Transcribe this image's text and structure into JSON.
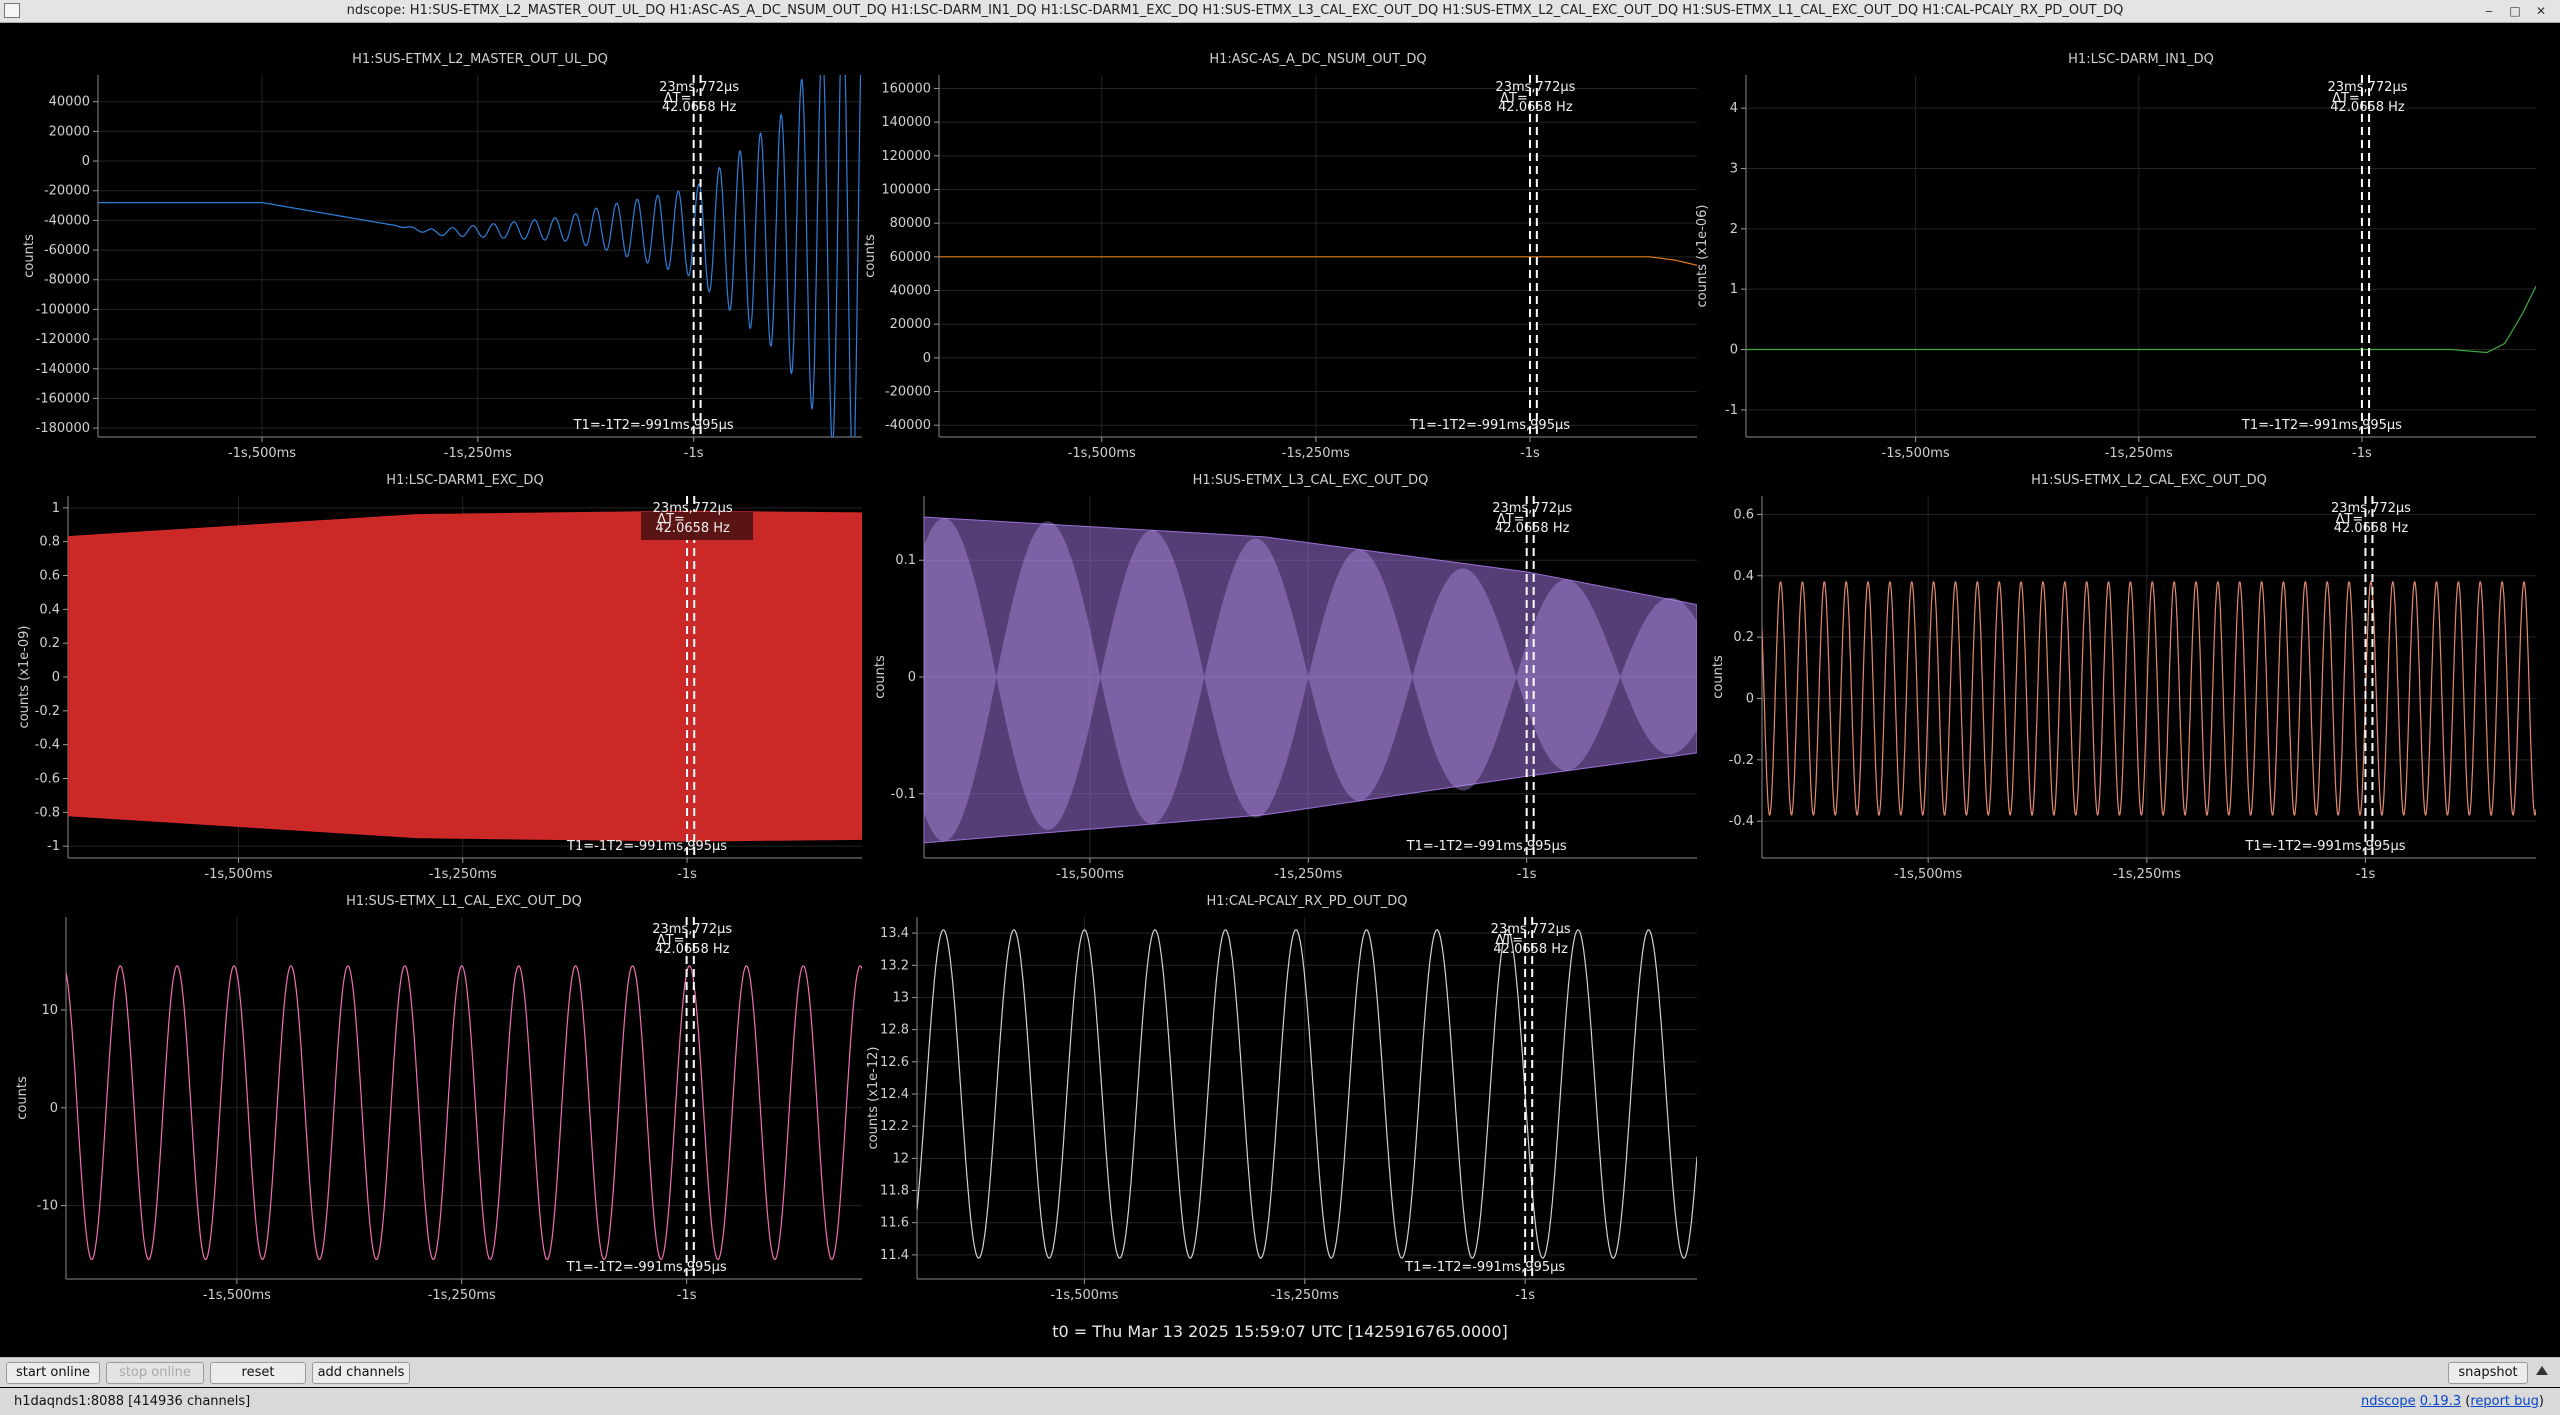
{
  "window": {
    "title": "ndscope: H1:SUS-ETMX_L2_MASTER_OUT_UL_DQ H1:ASC-AS_A_DC_NSUM_OUT_DQ H1:LSC-DARM_IN1_DQ H1:LSC-DARM1_EXC_DQ H1:SUS-ETMX_L3_CAL_EXC_OUT_DQ H1:SUS-ETMX_L2_CAL_EXC_OUT_DQ H1:SUS-ETMX_L1_CAL_EXC_OUT_DQ H1:CAL-PCALY_RX_PD_OUT_DQ",
    "minimize_glyph": "‒",
    "maximize_glyph": "□",
    "close_glyph": "✕"
  },
  "cursor": {
    "delta_label": "ΔT=",
    "delta_time": "23ms,772μs",
    "delta_freq": "42.0658 Hz",
    "t1_label": "T1=-1",
    "t2_label": "T2=-991ms,995μs",
    "t1": -1.0,
    "t2": -0.991995
  },
  "x_axis": {
    "min": -1.69,
    "max": -0.805,
    "ticks": [
      {
        "v": -1.5,
        "label": "-1s,500ms"
      },
      {
        "v": -1.25,
        "label": "-1s,250ms"
      },
      {
        "v": -1.0,
        "label": "-1s"
      }
    ]
  },
  "chart_data": [
    {
      "type": "line",
      "title": "H1:SUS-ETMX_L2_MASTER_OUT_UL_DQ",
      "ylabel": "counts",
      "color": "#2f7fd8",
      "ylim": [
        -186000,
        58000
      ],
      "yticks": [
        {
          "v": 40000,
          "label": "40000"
        },
        {
          "v": 20000,
          "label": "20000"
        },
        {
          "v": 0,
          "label": "0"
        },
        {
          "v": -20000,
          "label": "-20000"
        },
        {
          "v": -40000,
          "label": "-40000"
        },
        {
          "v": -60000,
          "label": "-60000"
        },
        {
          "v": -80000,
          "label": "-80000"
        },
        {
          "v": -100000,
          "label": "-100000"
        },
        {
          "v": -120000,
          "label": "-120000"
        },
        {
          "v": -140000,
          "label": "-140000"
        },
        {
          "v": -160000,
          "label": "-160000"
        },
        {
          "v": -180000,
          "label": "-180000"
        }
      ],
      "xlim": [
        -1.69,
        -0.805
      ],
      "signal": {
        "kind": "growing-oscillation",
        "base": [
          [
            -1.69,
            -28000
          ],
          [
            -1.5,
            -28000
          ],
          [
            -1.3,
            -48000
          ],
          [
            -1.1,
            -45000
          ],
          [
            -0.95,
            -50000
          ]
        ],
        "freq": 42,
        "amp": [
          [
            -1.35,
            0
          ],
          [
            -1.15,
            8000
          ],
          [
            -1.0,
            30000
          ],
          [
            -0.9,
            80000
          ],
          [
            -0.82,
            160000
          ]
        ]
      }
    },
    {
      "type": "line",
      "title": "H1:ASC-AS_A_DC_NSUM_OUT_DQ",
      "ylabel": "counts",
      "color": "#e07a20",
      "ylim": [
        -47000,
        168000
      ],
      "yticks": [
        {
          "v": 160000,
          "label": "160000"
        },
        {
          "v": 140000,
          "label": "140000"
        },
        {
          "v": 120000,
          "label": "120000"
        },
        {
          "v": 100000,
          "label": "100000"
        },
        {
          "v": 80000,
          "label": "80000"
        },
        {
          "v": 60000,
          "label": "60000"
        },
        {
          "v": 40000,
          "label": "40000"
        },
        {
          "v": 20000,
          "label": "20000"
        },
        {
          "v": 0,
          "label": "0"
        },
        {
          "v": -20000,
          "label": "-20000"
        },
        {
          "v": -40000,
          "label": "-40000"
        }
      ],
      "xlim": [
        -1.69,
        -0.805
      ],
      "signal": {
        "kind": "step",
        "points": [
          [
            -1.69,
            60000
          ],
          [
            -0.86,
            60000
          ],
          [
            -0.83,
            58000
          ],
          [
            -0.805,
            55000
          ]
        ]
      }
    },
    {
      "type": "line",
      "title": "H1:LSC-DARM_IN1_DQ",
      "ylabel": "counts (x1e-06)",
      "color": "#3faa3f",
      "ylim": [
        -1.45,
        4.55
      ],
      "yticks": [
        {
          "v": 4,
          "label": "4"
        },
        {
          "v": 3,
          "label": "3"
        },
        {
          "v": 2,
          "label": "2"
        },
        {
          "v": 1,
          "label": "1"
        },
        {
          "v": 0,
          "label": "0"
        },
        {
          "v": -1,
          "label": "-1"
        }
      ],
      "xlim": [
        -1.69,
        -0.805
      ],
      "signal": {
        "kind": "step",
        "points": [
          [
            -1.69,
            0
          ],
          [
            -0.9,
            0.0
          ],
          [
            -0.86,
            -0.05
          ],
          [
            -0.84,
            0.1
          ],
          [
            -0.82,
            0.6
          ],
          [
            -0.805,
            1.05
          ]
        ]
      }
    },
    {
      "type": "area",
      "title": "H1:LSC-DARM1_EXC_DQ",
      "ylabel": "counts (x1e-09)",
      "color": "#d62a2a",
      "ylim": [
        -1.07,
        1.07
      ],
      "yticks": [
        {
          "v": 1,
          "label": "1"
        },
        {
          "v": 0.8,
          "label": "0.8"
        },
        {
          "v": 0.6,
          "label": "0.6"
        },
        {
          "v": 0.4,
          "label": "0.4"
        },
        {
          "v": 0.2,
          "label": "0.2"
        },
        {
          "v": 0,
          "label": "0"
        },
        {
          "v": -0.2,
          "label": "-0.2"
        },
        {
          "v": -0.4,
          "label": "-0.4"
        },
        {
          "v": -0.6,
          "label": "-0.6"
        },
        {
          "v": -0.8,
          "label": "-0.8"
        },
        {
          "v": -1,
          "label": "-1"
        }
      ],
      "xlim": [
        -1.69,
        -0.805
      ],
      "signal": {
        "kind": "envelope",
        "upper": [
          [
            -1.69,
            0.83
          ],
          [
            -1.3,
            0.96
          ],
          [
            -1.0,
            0.98
          ],
          [
            -0.805,
            0.97
          ]
        ],
        "lower": [
          [
            -1.69,
            -0.82
          ],
          [
            -1.3,
            -0.95
          ],
          [
            -1.0,
            -0.97
          ],
          [
            -0.805,
            -0.96
          ]
        ]
      }
    },
    {
      "type": "area",
      "title": "H1:SUS-ETMX_L3_CAL_EXC_OUT_DQ",
      "ylabel": "counts",
      "color": "#9b6fd6",
      "ylim": [
        -0.155,
        0.155
      ],
      "yticks": [
        {
          "v": 0.1,
          "label": "0.1"
        },
        {
          "v": 0,
          "label": "0"
        },
        {
          "v": -0.1,
          "label": "-0.1"
        }
      ],
      "xlim": [
        -1.69,
        -0.805
      ],
      "signal": {
        "kind": "envelope",
        "upper": [
          [
            -1.69,
            0.137
          ],
          [
            -1.3,
            0.12
          ],
          [
            -1.0,
            0.09
          ],
          [
            -0.805,
            0.062
          ]
        ],
        "lower": [
          [
            -1.69,
            -0.142
          ],
          [
            -1.3,
            -0.118
          ],
          [
            -1.0,
            -0.085
          ],
          [
            -0.805,
            -0.065
          ]
        ]
      }
    },
    {
      "type": "line",
      "title": "H1:SUS-ETMX_L2_CAL_EXC_OUT_DQ",
      "ylabel": "counts",
      "color": "#e28a70",
      "ylim": [
        -0.52,
        0.66
      ],
      "yticks": [
        {
          "v": 0.6,
          "label": "0.6"
        },
        {
          "v": 0.4,
          "label": "0.4"
        },
        {
          "v": 0.2,
          "label": "0.2"
        },
        {
          "v": 0,
          "label": "0"
        },
        {
          "v": -0.2,
          "label": "-0.2"
        },
        {
          "v": -0.4,
          "label": "-0.4"
        }
      ],
      "xlim": [
        -1.69,
        -0.805
      ],
      "signal": {
        "kind": "sine",
        "offset": 0.0,
        "amp": 0.38,
        "freq": 40
      }
    },
    {
      "type": "line",
      "title": "H1:SUS-ETMX_L1_CAL_EXC_OUT_DQ",
      "ylabel": "counts",
      "color": "#f06fb4",
      "ylim": [
        -17.5,
        19.5
      ],
      "yticks": [
        {
          "v": 10,
          "label": "10"
        },
        {
          "v": 0,
          "label": "0"
        },
        {
          "v": -10,
          "label": "-10"
        }
      ],
      "xlim": [
        -1.69,
        -0.805
      ],
      "signal": {
        "kind": "sine",
        "offset": -0.5,
        "amp": 15,
        "freq": 15.8
      }
    },
    {
      "type": "line",
      "title": "H1:CAL-PCALY_RX_PD_OUT_DQ",
      "ylabel": "counts (x1e-12)",
      "color": "#d2d2d2",
      "ylim": [
        11.25,
        13.5
      ],
      "yticks": [
        {
          "v": 13.4,
          "label": "13.4"
        },
        {
          "v": 13.2,
          "label": "13.2"
        },
        {
          "v": 13,
          "label": "13"
        },
        {
          "v": 12.8,
          "label": "12.8"
        },
        {
          "v": 12.6,
          "label": "12.6"
        },
        {
          "v": 12.4,
          "label": "12.4"
        },
        {
          "v": 12.2,
          "label": "12.2"
        },
        {
          "v": 12,
          "label": "12"
        },
        {
          "v": 11.8,
          "label": "11.8"
        },
        {
          "v": 11.6,
          "label": "11.6"
        },
        {
          "v": 11.4,
          "label": "11.4"
        }
      ],
      "xlim": [
        -1.69,
        -0.805
      ],
      "signal": {
        "kind": "sine",
        "offset": 12.4,
        "amp": 1.02,
        "freq": 12.5
      }
    }
  ],
  "t0_label": "t0 = Thu Mar 13 2025 15:59:07 UTC [1425916765.0000]",
  "toolbar": {
    "start_online": "start online",
    "stop_online": "stop online",
    "reset": "reset",
    "add_channels": "add channels",
    "snapshot": "snapshot"
  },
  "status": {
    "server": "h1daqnds1:8088  [414936 channels]",
    "app_name": "ndscope",
    "version": "0.19.3",
    "report_bug": "report bug"
  }
}
